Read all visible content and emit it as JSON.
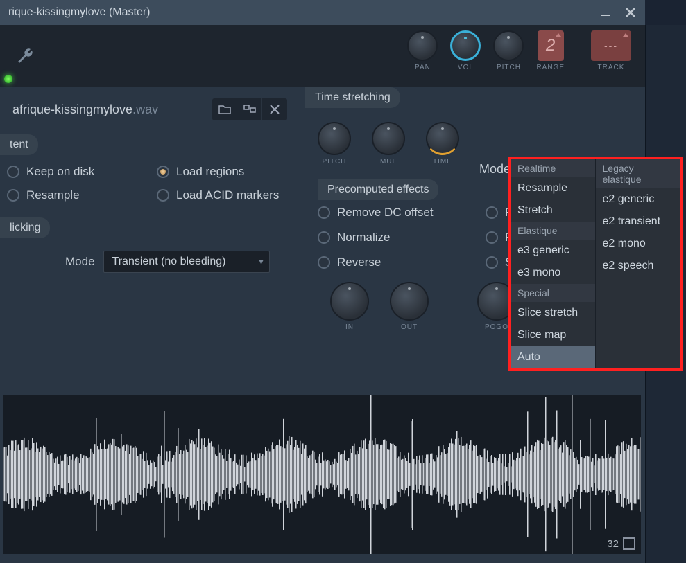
{
  "window": {
    "title_prefix": "rique-kissingmylove",
    "title_suffix": " (Master)"
  },
  "toolbar": {
    "knobs": {
      "pan": "PAN",
      "vol": "VOL",
      "pitch": "PITCH",
      "range": "RANGE",
      "track": "TRACK"
    },
    "range_value": "2",
    "track_value": "---"
  },
  "file": {
    "name": "afrique-kissingmylove",
    "ext": ".wav"
  },
  "sections": {
    "content": "tent",
    "declicking": "licking",
    "timestretch": "Time stretching",
    "precomputed": "Precomputed effects"
  },
  "content_opts": {
    "keep_on_disk": "Keep on disk",
    "load_regions": "Load regions",
    "resample": "Resample",
    "load_acid": "Load ACID markers"
  },
  "declick": {
    "mode_label": "Mode",
    "mode_value": "Transient (no bleeding)"
  },
  "timestretch": {
    "knob_pitch": "PITCH",
    "knob_mul": "MUL",
    "knob_time": "TIME",
    "mode_label": "Mode",
    "mode_value": "Auto"
  },
  "precomputed": {
    "remove_dc": "Remove DC offset",
    "normalize": "Normalize",
    "reverse": "Reverse",
    "rev": "Rev",
    "fade": "Fad",
    "swap": "Sw",
    "knob_in": "IN",
    "knob_out": "OUT",
    "knob_pogo": "POGO"
  },
  "mode_menu": {
    "col1": {
      "hdr1": "Realtime",
      "resample": "Resample",
      "stretch": "Stretch",
      "hdr2": "Elastique",
      "e3gen": "e3 generic",
      "e3mono": "e3 mono",
      "hdr3": "Special",
      "slicestretch": "Slice stretch",
      "slicemap": "Slice map",
      "auto": "Auto"
    },
    "col2": {
      "hdr": "Legacy elastique",
      "e2gen": "e2 generic",
      "e2trans": "e2 transient",
      "e2mono": "e2 mono",
      "e2speech": "e2 speech"
    }
  },
  "waveform": {
    "counter": "32"
  }
}
